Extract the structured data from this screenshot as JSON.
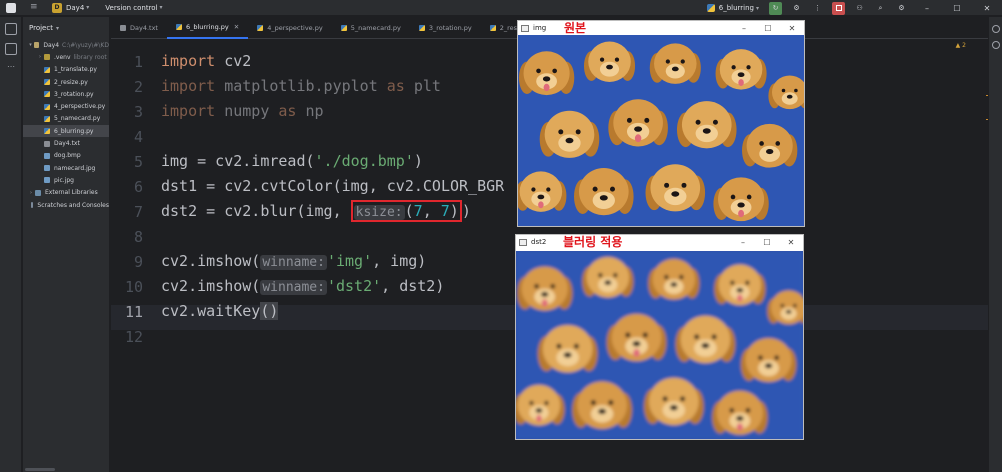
{
  "titlebar": {
    "project_badge": "D",
    "project_name": "Day4",
    "version_control": "Version control",
    "run_config": "6_blurring"
  },
  "project_panel": {
    "title": "Project",
    "tree": [
      {
        "label": "Day4",
        "muted": "C:\\#\\yuzy\\#\\KD",
        "type": "folder",
        "level": 0,
        "arrow": "v"
      },
      {
        "label": ".venv",
        "muted": "library root",
        "type": "venv",
        "level": 1,
        "arrow": ">"
      },
      {
        "label": "1_translate.py",
        "muted": "",
        "type": "py",
        "level": 1,
        "arrow": ""
      },
      {
        "label": "2_resize.py",
        "muted": "",
        "type": "py",
        "level": 1,
        "arrow": ""
      },
      {
        "label": "3_rotation.py",
        "muted": "",
        "type": "py",
        "level": 1,
        "arrow": ""
      },
      {
        "label": "4_perspective.py",
        "muted": "",
        "type": "py",
        "level": 1,
        "arrow": ""
      },
      {
        "label": "5_namecard.py",
        "muted": "",
        "type": "py",
        "level": 1,
        "arrow": ""
      },
      {
        "label": "6_blurring.py",
        "muted": "",
        "type": "py",
        "level": 1,
        "arrow": "",
        "selected": true
      },
      {
        "label": "Day4.txt",
        "muted": "",
        "type": "txt",
        "level": 1,
        "arrow": ""
      },
      {
        "label": "dog.bmp",
        "muted": "",
        "type": "img",
        "level": 1,
        "arrow": ""
      },
      {
        "label": "namecard.jpg",
        "muted": "",
        "type": "img",
        "level": 1,
        "arrow": ""
      },
      {
        "label": "pic.jpg",
        "muted": "",
        "type": "img",
        "level": 1,
        "arrow": ""
      },
      {
        "label": "External Libraries",
        "muted": "",
        "type": "lib",
        "level": 0,
        "arrow": ">"
      },
      {
        "label": "Scratches and Consoles",
        "muted": "",
        "type": "scr",
        "level": 0,
        "arrow": ""
      }
    ]
  },
  "tabs": [
    {
      "label": "Day4.txt",
      "type": "txt",
      "active": false
    },
    {
      "label": "6_blurring.py",
      "type": "py",
      "active": true
    },
    {
      "label": "4_perspective.py",
      "type": "py",
      "active": false
    },
    {
      "label": "5_namecard.py",
      "type": "py",
      "active": false
    },
    {
      "label": "3_rotation.py",
      "type": "py",
      "active": false
    },
    {
      "label": "2_resize.py",
      "type": "py",
      "active": false
    }
  ],
  "editor": {
    "warning_count": "2",
    "current_line": "11",
    "lines": [
      {
        "n": "1",
        "segs": [
          {
            "t": "import",
            "c": "kw"
          },
          {
            "t": " cv2",
            "c": ""
          }
        ]
      },
      {
        "n": "2",
        "dim": true,
        "segs": [
          {
            "t": "import",
            "c": "kw"
          },
          {
            "t": " matplotlib.pyplot ",
            "c": ""
          },
          {
            "t": "as",
            "c": "kw"
          },
          {
            "t": " plt",
            "c": ""
          }
        ]
      },
      {
        "n": "3",
        "dim": true,
        "segs": [
          {
            "t": "import",
            "c": "kw"
          },
          {
            "t": " numpy ",
            "c": ""
          },
          {
            "t": "as",
            "c": "kw"
          },
          {
            "t": " np",
            "c": ""
          }
        ]
      },
      {
        "n": "4",
        "segs": []
      },
      {
        "n": "5",
        "segs": [
          {
            "t": "img = cv2.imread(",
            "c": ""
          },
          {
            "t": "'./dog.bmp'",
            "c": "str"
          },
          {
            "t": ")",
            "c": ""
          }
        ]
      },
      {
        "n": "6",
        "segs": [
          {
            "t": "dst1 = cv2.cvtColor(img, cv2.COLOR_BGR",
            "c": ""
          }
        ]
      },
      {
        "n": "7",
        "segs": [
          {
            "t": "dst2 = cv2.blur(img, ",
            "c": ""
          },
          {
            "t": "ksize:",
            "c": "hint",
            "box": true
          },
          {
            "t": "(",
            "c": "",
            "box": true
          },
          {
            "t": "7",
            "c": "num",
            "box": true
          },
          {
            "t": ", ",
            "c": "",
            "box": true
          },
          {
            "t": "7",
            "c": "num",
            "box": true
          },
          {
            "t": ")",
            "c": "",
            "box": true
          },
          {
            "t": ")",
            "c": ""
          }
        ]
      },
      {
        "n": "8",
        "segs": []
      },
      {
        "n": "9",
        "segs": [
          {
            "t": "cv2.imshow(",
            "c": ""
          },
          {
            "t": "winname:",
            "c": "hint"
          },
          {
            "t": "'img'",
            "c": "str"
          },
          {
            "t": ", img)",
            "c": ""
          }
        ]
      },
      {
        "n": "10",
        "segs": [
          {
            "t": "cv2.imshow(",
            "c": ""
          },
          {
            "t": "winname:",
            "c": "hint"
          },
          {
            "t": "'dst2'",
            "c": "str"
          },
          {
            "t": ", dst2)",
            "c": ""
          }
        ]
      },
      {
        "n": "11",
        "segs": [
          {
            "t": "cv2.waitKey",
            "c": ""
          },
          {
            "t": "()",
            "c": "paren"
          }
        ]
      },
      {
        "n": "12",
        "segs": []
      }
    ]
  },
  "windows": {
    "original": {
      "title": "img",
      "label": "원본",
      "minimize": "–",
      "maximize": "☐",
      "close": "✕"
    },
    "blurred": {
      "title": "dst2",
      "label": "블러링 적용",
      "minimize": "–",
      "maximize": "☐",
      "close": "✕"
    }
  },
  "colors": {
    "accent": "#3574f0",
    "highlight_box": "#e0272e",
    "window_label": "#e0141c"
  }
}
